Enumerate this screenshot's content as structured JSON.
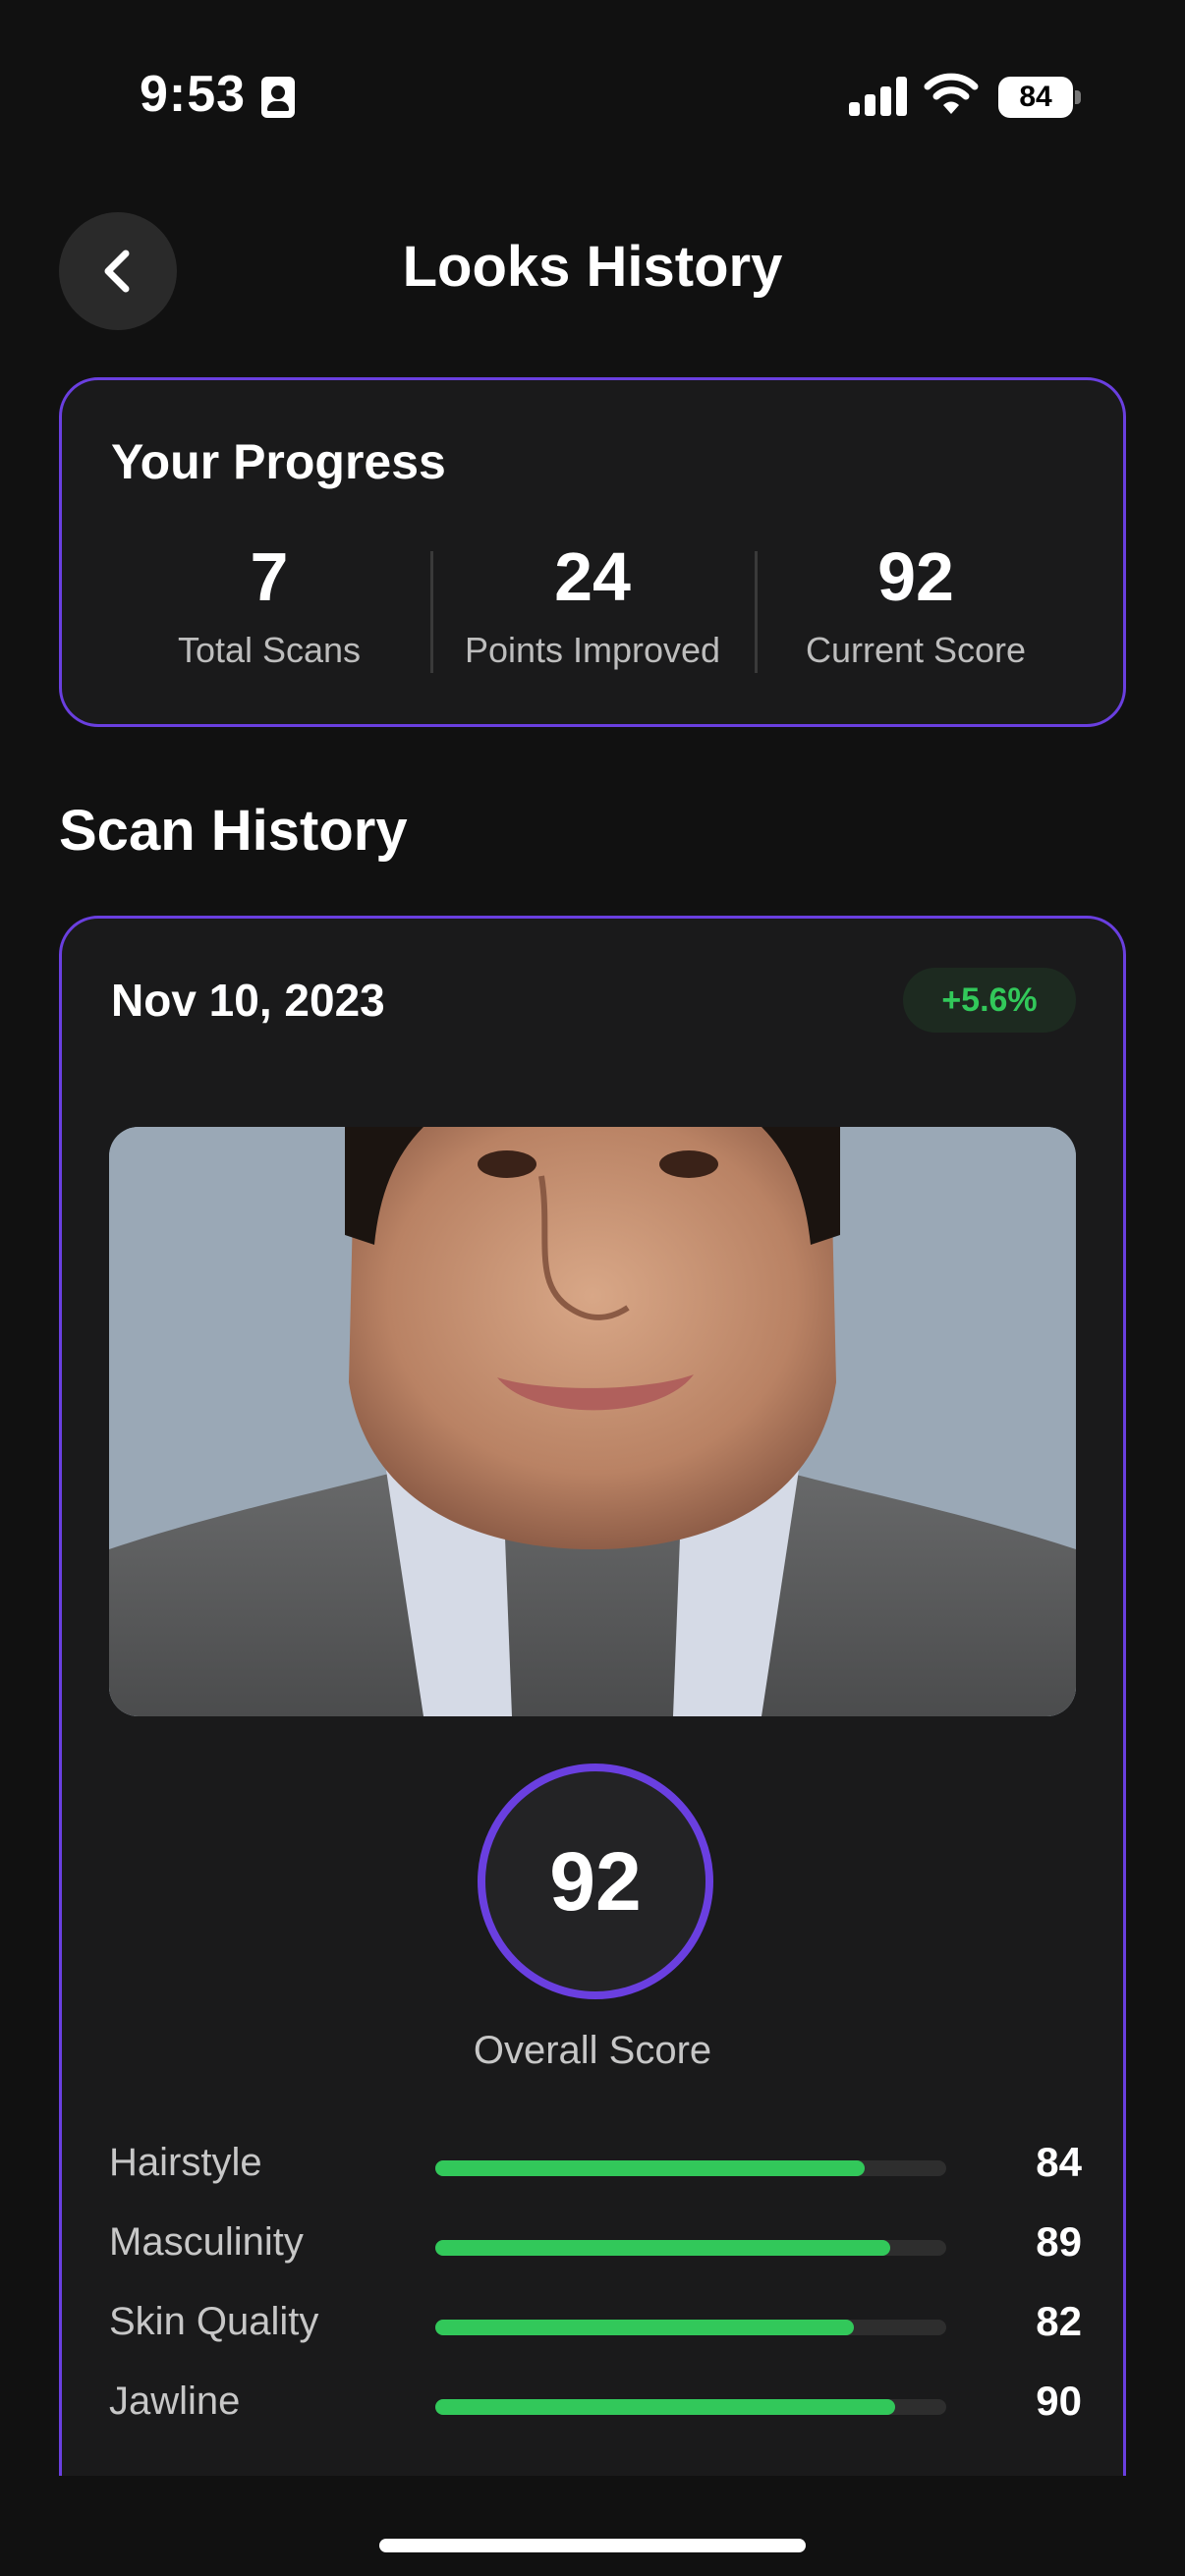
{
  "status_bar": {
    "time": "9:53",
    "battery": "84",
    "icons": [
      "contact-card-icon",
      "cellular-signal-icon",
      "wifi-icon",
      "battery-icon"
    ]
  },
  "header": {
    "title": "Looks History",
    "back_icon": "chevron-left-icon"
  },
  "progress": {
    "title": "Your Progress",
    "stats": [
      {
        "value": "7",
        "label": "Total Scans"
      },
      {
        "value": "24",
        "label": "Points Improved"
      },
      {
        "value": "92",
        "label": "Current Score"
      }
    ]
  },
  "scan_history": {
    "title": "Scan History",
    "scans": [
      {
        "date": "Nov 10, 2023",
        "change": "+5.6%",
        "overall_score": "92",
        "overall_label": "Overall Score",
        "metrics": [
          {
            "label": "Hairstyle",
            "value": "84",
            "level": 0.84
          },
          {
            "label": "Masculinity",
            "value": "89",
            "level": 0.89
          },
          {
            "label": "Skin Quality",
            "value": "82",
            "level": 0.82
          },
          {
            "label": "Jawline",
            "value": "90",
            "level": 0.9
          }
        ]
      }
    ]
  },
  "colors": {
    "background": "#111111",
    "card": "#1a1a1b",
    "accent_purple": "#6a3fe0",
    "positive_green": "#32c85a"
  }
}
